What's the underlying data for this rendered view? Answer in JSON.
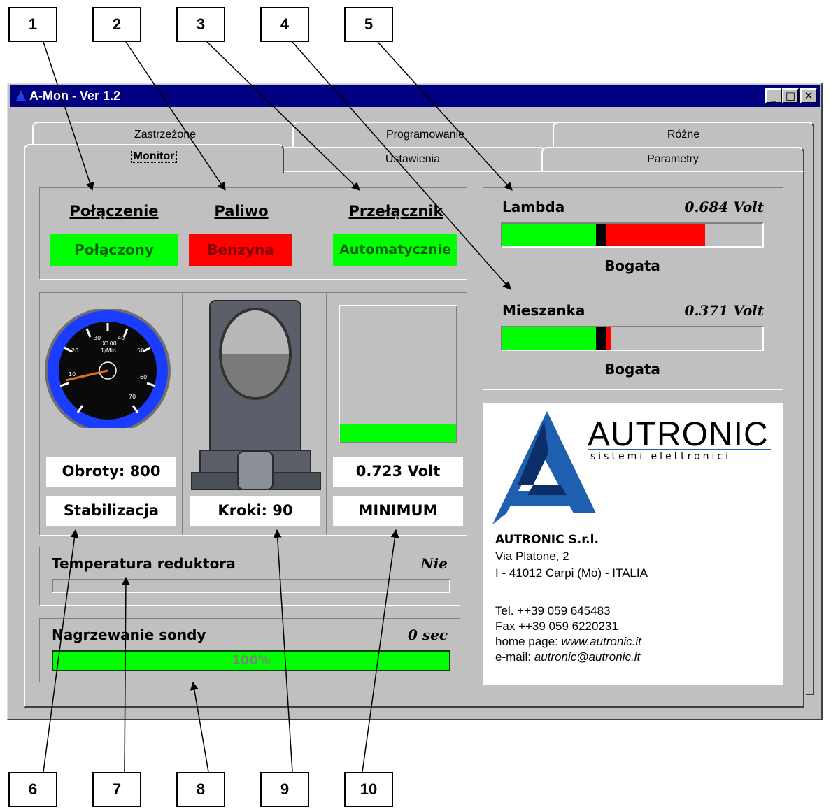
{
  "callouts": [
    "1",
    "2",
    "3",
    "4",
    "5",
    "6",
    "7",
    "8",
    "9",
    "10"
  ],
  "window": {
    "title": "A-Mon - Ver 1.2"
  },
  "tabs": {
    "back": [
      "Zastrzeżone",
      "Programowanie",
      "Różne"
    ],
    "front": [
      "Monitor",
      "Ustawienia",
      "Parametry"
    ],
    "selected": "Monitor"
  },
  "status": {
    "connection": {
      "label": "Połączenie",
      "value": "Połączony",
      "color": "#00ff00"
    },
    "fuel": {
      "label": "Paliwo",
      "value": "Benzyna",
      "color": "#ff0000"
    },
    "switch": {
      "label": "Przełącznik",
      "value": "Automatycznie",
      "color": "#00ff00"
    }
  },
  "tachometer": {
    "scale_labels": [
      "10",
      "20",
      "30",
      "40",
      "50",
      "60",
      "70",
      "X100",
      "1/Min"
    ],
    "rpm_value": "Obroty: 800",
    "mode": "Stabilizacja"
  },
  "stepper": {
    "value": "Kroki: 90"
  },
  "voltage_meter": {
    "value": "0.723 Volt",
    "level": "MINIMUM",
    "fill_fraction": 0.13
  },
  "lambda": {
    "label": "Lambda",
    "volt": "0.684 Volt",
    "state": "Bogata",
    "green_fraction": 0.36,
    "red_fraction": 0.78
  },
  "mixture": {
    "label": "Mieszanka",
    "volt": "0.371 Volt",
    "state": "Bogata",
    "green_fraction": 0.36,
    "red_fraction": 0.42
  },
  "reducer_temp": {
    "label": "Temperatura reduktora",
    "value": "Nie"
  },
  "probe_heating": {
    "label": "Nagrzewanie sondy",
    "value": "0 sec",
    "progress": "100%",
    "progress_fraction": 1.0
  },
  "company": {
    "logo_text": "AUTRONIC",
    "logo_sub": "sistemi elettronici",
    "name": "AUTRONIC S.r.l.",
    "address1": "Via Platone, 2",
    "address2": "I - 41012 Carpi (Mo) - ITALIA",
    "tel": "Tel. ++39 059 645483",
    "fax": "Fax ++39 059 6220231",
    "homepage_prefix": "home page: ",
    "homepage": "www.autronic.it",
    "email_prefix": "e-mail: ",
    "email": "autronic@autronic.it"
  },
  "colors": {
    "green": "#00ff00",
    "red": "#ff0000",
    "titlebar": "#000080",
    "gauge_blue": "#1a3cff"
  }
}
